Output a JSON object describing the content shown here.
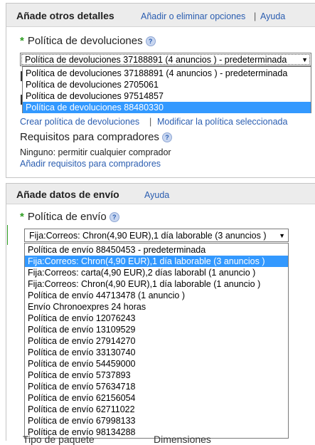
{
  "details": {
    "title": "Añade otros detalles",
    "link_options": "Añadir o eliminar opciones",
    "separator": "|",
    "link_help": "Ayuda",
    "return_policy": {
      "label": "Política de devoluciones",
      "selected": "Política de devoluciones 37188891 (4 anuncios ) - predeterminada",
      "options": [
        "Política de devoluciones 37188891 (4 anuncios ) - predeterminada",
        "Política de devoluciones 2705061",
        "Política de devoluciones 97514857",
        "Política de devoluciones 88480330"
      ],
      "highlighted_index": 3,
      "create_link": "Crear política de devoluciones",
      "modify_link": "Modificar la política seleccionada"
    },
    "buyer_requirements": {
      "label": "Requisitos para compradores",
      "value": "Ninguno: permitir cualquier comprador",
      "add_link": "Añadir requisitos para compradores"
    }
  },
  "shipping": {
    "title": "Añade datos de envío",
    "link_help": "Ayuda",
    "shipping_policy": {
      "label": "Política de envío",
      "selected": "Fija:Correos: Chron(4,90 EUR),1 día laborable (3 anuncios )",
      "options": [
        "Política de envío 88450453 - predeterminada",
        "Fija:Correos: Chron(4,90 EUR),1 día laborable (3 anuncios )",
        "Fija:Correos: carta(4,90 EUR),2 días laborabl (1 anuncio )",
        "Fija:Correos: Chron(4,90 EUR),1 día laborable (1 anuncio )",
        "Política de envío 44713478 (1 anuncio )",
        "Envío Chronoexpres 24 horas",
        "Política de envío 12076243",
        "Política de envío 13109529",
        "Política de envío 27914270",
        "Política de envío 33130740",
        "Política de envío 54459000",
        "Política de envío 5737893",
        "Política de envío 57634718",
        "Política de envío 62156054",
        "Política de envío 62711022",
        "Política de envío 67998133",
        "Política de envío 98134288"
      ],
      "highlighted_index": 1
    },
    "bottom_partial_left": "Tipo de paquete",
    "bottom_partial_right": "Dimensiones"
  },
  "colors": {
    "link": "#2a5db0",
    "highlight": "#3399ff",
    "required": "#2c9c1f"
  },
  "icons": {
    "help": "help-icon",
    "dropdown": "chevron-down-icon",
    "required": "asterisk-icon"
  }
}
